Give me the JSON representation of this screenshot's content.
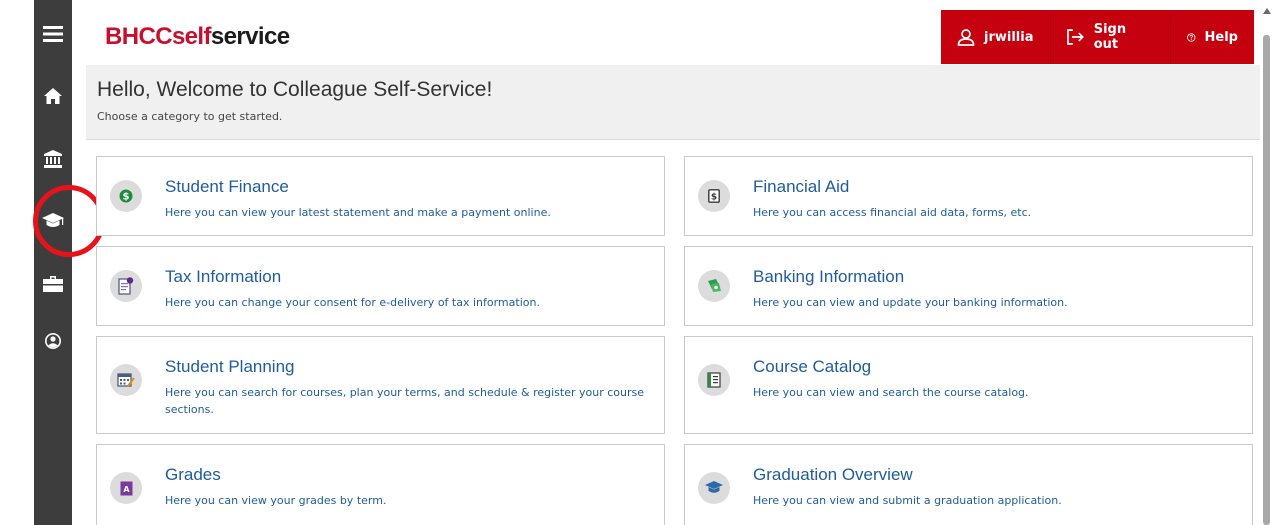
{
  "app": {
    "logo_part1": "BHCC",
    "logo_part2": "self",
    "logo_part3": "service"
  },
  "header": {
    "user_label": "jrwillia",
    "signout_label": "Sign out",
    "help_label": "Help"
  },
  "sidebar": {
    "items": [
      {
        "icon": "menu-icon"
      },
      {
        "icon": "home-icon"
      },
      {
        "icon": "bank-icon"
      },
      {
        "icon": "graduation-cap-icon"
      },
      {
        "icon": "briefcase-icon"
      },
      {
        "icon": "user-circle-icon"
      }
    ]
  },
  "welcome": {
    "title": "Hello, Welcome to Colleague Self-Service!",
    "subtitle": "Choose a category to get started."
  },
  "categories": [
    {
      "title": "Student Finance",
      "description": "Here you can view your latest statement and make a payment online.",
      "icon": "dollar-coin-icon"
    },
    {
      "title": "Financial Aid",
      "description": "Here you can access financial aid data, forms, etc.",
      "icon": "dollar-bill-icon"
    },
    {
      "title": "Tax Information",
      "description": "Here you can change your consent for e-delivery of tax information.",
      "icon": "tax-document-icon"
    },
    {
      "title": "Banking Information",
      "description": "Here you can view and update your banking information.",
      "icon": "money-icon"
    },
    {
      "title": "Student Planning",
      "description": "Here you can search for courses, plan your terms, and schedule & register your course sections.",
      "icon": "calendar-icon"
    },
    {
      "title": "Course Catalog",
      "description": "Here you can view and search the course catalog.",
      "icon": "catalog-book-icon"
    },
    {
      "title": "Grades",
      "description": "Here you can view your grades by term.",
      "icon": "grade-icon"
    },
    {
      "title": "Graduation Overview",
      "description": "Here you can view and submit a graduation application.",
      "icon": "graduation-cap-icon"
    }
  ],
  "colors": {
    "brand_red": "#c5000f",
    "sidebar_bg": "#3d3d3d",
    "link_blue": "#1f5c99"
  }
}
